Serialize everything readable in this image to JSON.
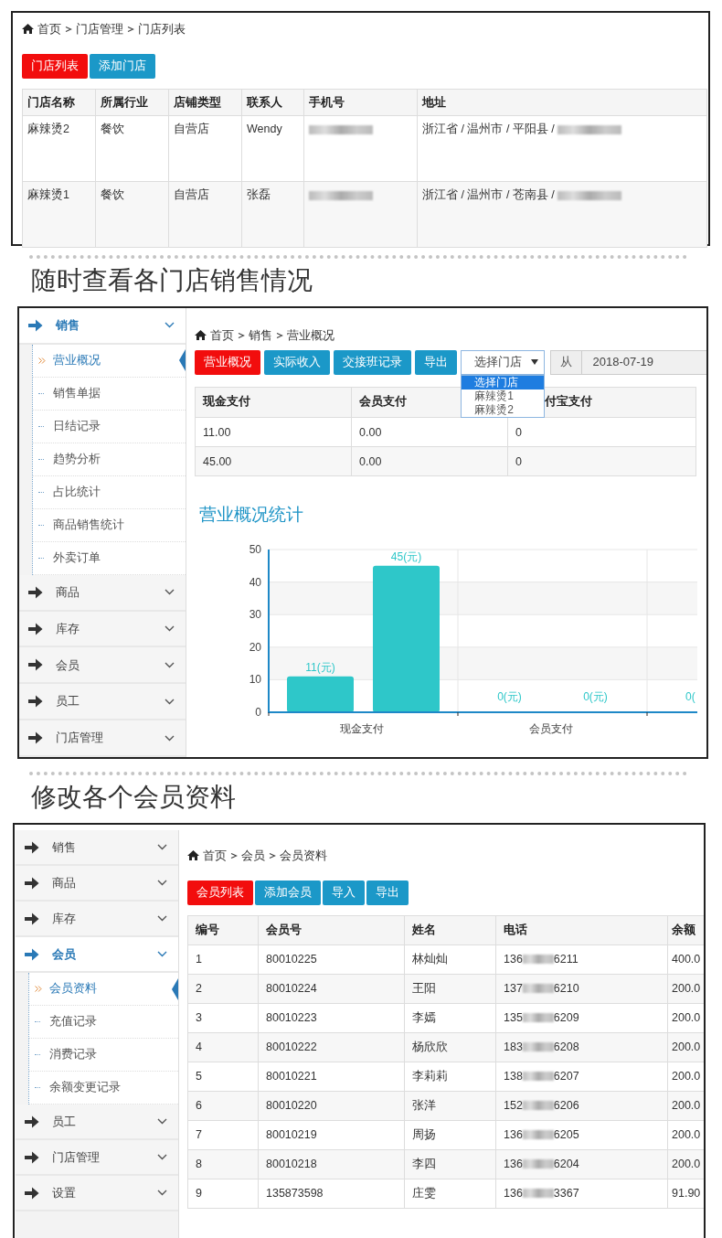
{
  "stores": {
    "breadcrumb": [
      "首页",
      "门店管理",
      "门店列表"
    ],
    "buttons": [
      {
        "label": "门店列表",
        "selected": true
      },
      {
        "label": "添加门店",
        "selected": false
      }
    ],
    "table": {
      "columns": [
        "门店名称",
        "所属行业",
        "店铺类型",
        "联系人",
        "手机号",
        "地址"
      ],
      "rows": [
        {
          "cells": [
            "麻辣烫2",
            "餐饮",
            "自营店",
            "Wendy"
          ],
          "phone_redacted": true,
          "address": "浙江省 / 温州市 / 平阳县 /",
          "address_redacted": true
        },
        {
          "cells": [
            "麻辣烫1",
            "餐饮",
            "自营店",
            "张磊"
          ],
          "phone_redacted": true,
          "address": "浙江省 / 温州市 / 苍南县 /",
          "address_redacted": true
        }
      ]
    }
  },
  "sales": {
    "heading": "随时查看各门店销售情况",
    "sidebar": [
      {
        "label": "销售",
        "selected": true,
        "expanded": true,
        "children": [
          {
            "label": "营业概况",
            "selected": true
          },
          {
            "label": "销售单据",
            "selected": false
          },
          {
            "label": "日结记录",
            "selected": false
          },
          {
            "label": "趋势分析",
            "selected": false
          },
          {
            "label": "占比统计",
            "selected": false
          },
          {
            "label": "商品销售统计",
            "selected": false
          },
          {
            "label": "外卖订单",
            "selected": false
          }
        ]
      },
      {
        "label": "商品",
        "selected": false,
        "expanded": false
      },
      {
        "label": "库存",
        "selected": false,
        "expanded": false
      },
      {
        "label": "会员",
        "selected": false,
        "expanded": false
      },
      {
        "label": "员工",
        "selected": false,
        "expanded": false
      },
      {
        "label": "门店管理",
        "selected": false,
        "expanded": false
      }
    ],
    "breadcrumb": [
      "首页",
      "销售",
      "营业概况"
    ],
    "buttons": [
      {
        "label": "营业概况",
        "selected": true
      },
      {
        "label": "实际收入",
        "selected": false
      },
      {
        "label": "交接班记录",
        "selected": false
      },
      {
        "label": "导出",
        "selected": false
      }
    ],
    "store_select": {
      "value": "选择门店",
      "open": true,
      "options": [
        {
          "label": "选择门店",
          "selected": true
        },
        {
          "label": "麻辣烫1",
          "selected": false
        },
        {
          "label": "麻辣烫2",
          "selected": false
        }
      ]
    },
    "date_filter": {
      "prefix": "从",
      "value": "2018-07-19"
    },
    "table": {
      "columns": [
        "现金支付",
        "会员支付",
        "付宝支付"
      ],
      "rows": [
        [
          "11.00",
          "0.00",
          "0"
        ],
        [
          "45.00",
          "0.00",
          "0"
        ]
      ]
    },
    "chart": {
      "chart_data": {
        "type": "bar",
        "title": "营业概况统计",
        "categories": [
          "现金支付",
          "会员支付"
        ],
        "series": [
          {
            "color": "#2ec7c9",
            "values": [
              11,
              0
            ]
          },
          {
            "color": "#2ec7c9",
            "values": [
              45,
              0
            ]
          }
        ],
        "grid": true,
        "ylim": [
          0,
          50
        ],
        "yticks": [
          0,
          10,
          20,
          30,
          40,
          50
        ],
        "value_labels": [
          [
            "11(元)",
            "0(元)"
          ],
          [
            "45(元)",
            "0(元)"
          ]
        ]
      },
      "clipped_label": "0("
    }
  },
  "members": {
    "heading": "修改各个会员资料",
    "sidebar": [
      {
        "label": "销售",
        "selected": false,
        "expanded": false
      },
      {
        "label": "商品",
        "selected": false,
        "expanded": false
      },
      {
        "label": "库存",
        "selected": false,
        "expanded": false
      },
      {
        "label": "会员",
        "selected": true,
        "expanded": true,
        "children": [
          {
            "label": "会员资料",
            "selected": true
          },
          {
            "label": "充值记录",
            "selected": false
          },
          {
            "label": "消费记录",
            "selected": false
          },
          {
            "label": "余额变更记录",
            "selected": false
          }
        ]
      },
      {
        "label": "员工",
        "selected": false,
        "expanded": false
      },
      {
        "label": "门店管理",
        "selected": false,
        "expanded": false
      },
      {
        "label": "设置",
        "selected": false,
        "expanded": false
      }
    ],
    "breadcrumb": [
      "首页",
      "会员",
      "会员资料"
    ],
    "buttons": [
      {
        "label": "会员列表",
        "selected": true
      },
      {
        "label": "添加会员",
        "selected": false
      },
      {
        "label": "导入",
        "selected": false
      },
      {
        "label": "导出",
        "selected": false
      }
    ],
    "table": {
      "columns": [
        "编号",
        "会员号",
        "姓名",
        "电话",
        "余额"
      ],
      "rows": [
        {
          "id": "1",
          "member_no": "80010225",
          "name": "林灿灿",
          "phone_prefix": "136",
          "phone_masked": true,
          "phone_suffix": "6211",
          "balance": "400.0"
        },
        {
          "id": "2",
          "member_no": "80010224",
          "name": "王阳",
          "phone_prefix": "137",
          "phone_masked": true,
          "phone_suffix": "6210",
          "balance": "200.0"
        },
        {
          "id": "3",
          "member_no": "80010223",
          "name": "李嫣",
          "phone_prefix": "135",
          "phone_masked": true,
          "phone_suffix": "6209",
          "balance": "200.0"
        },
        {
          "id": "4",
          "member_no": "80010222",
          "name": "杨欣欣",
          "phone_prefix": "183",
          "phone_masked": true,
          "phone_suffix": "6208",
          "balance": "200.0"
        },
        {
          "id": "5",
          "member_no": "80010221",
          "name": "李莉莉",
          "phone_prefix": "138",
          "phone_masked": true,
          "phone_suffix": "6207",
          "balance": "200.0"
        },
        {
          "id": "6",
          "member_no": "80010220",
          "name": "张洋",
          "phone_prefix": "152",
          "phone_masked": true,
          "phone_suffix": "6206",
          "balance": "200.0"
        },
        {
          "id": "7",
          "member_no": "80010219",
          "name": "周扬",
          "phone_prefix": "136",
          "phone_masked": true,
          "phone_suffix": "6205",
          "balance": "200.0"
        },
        {
          "id": "8",
          "member_no": "80010218",
          "name": "李四",
          "phone_prefix": "136",
          "phone_masked": true,
          "phone_suffix": "6204",
          "balance": "200.0"
        },
        {
          "id": "9",
          "member_no": "135873598",
          "name": "庄雯",
          "phone_prefix": "136",
          "phone_masked": true,
          "phone_suffix": "3367",
          "balance": "91.90"
        }
      ]
    }
  }
}
